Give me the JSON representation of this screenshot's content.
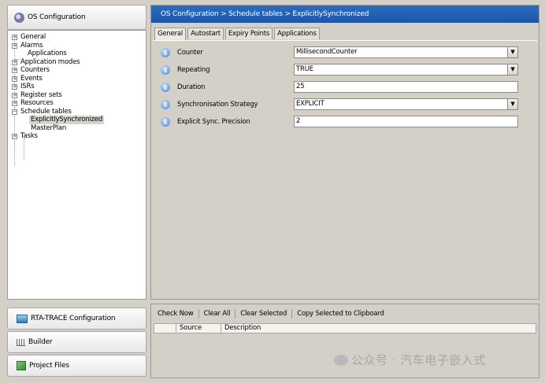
{
  "left_panel": {
    "title": "OS Configuration",
    "tree": [
      {
        "label": "General",
        "expandable": true
      },
      {
        "label": "Alarms",
        "expandable": true
      },
      {
        "label": "Applications",
        "expandable": false
      },
      {
        "label": "Application modes",
        "expandable": true
      },
      {
        "label": "Counters",
        "expandable": true
      },
      {
        "label": "Events",
        "expandable": true
      },
      {
        "label": "ISRs",
        "expandable": true
      },
      {
        "label": "Register sets",
        "expandable": true
      },
      {
        "label": "Resources",
        "expandable": true
      },
      {
        "label": "Schedule tables",
        "expandable": true,
        "expanded": true
      },
      {
        "label": "ExplicitlySynchronized",
        "child": true,
        "selected": true
      },
      {
        "label": "MasterPlan",
        "child": true
      },
      {
        "label": "Tasks",
        "expandable": true
      }
    ],
    "buttons": {
      "trace": "RTA-TRACE Configuration",
      "builder": "Builder",
      "project_files": "Project Files"
    }
  },
  "main": {
    "breadcrumb": "OS Configuration  >  Schedule tables  >  ExplicitlySynchronized",
    "tabs": [
      "General",
      "Autostart",
      "Expiry Points",
      "Applications"
    ],
    "active_tab": "General",
    "fields": [
      {
        "label": "Counter",
        "value": "MillisecondCounter",
        "type": "dropdown"
      },
      {
        "label": "Repeating",
        "value": "TRUE",
        "type": "dropdown"
      },
      {
        "label": "Duration",
        "value": "25",
        "type": "text"
      },
      {
        "label": "Synchronisation Strategy",
        "value": "EXPLICIT",
        "type": "dropdown"
      },
      {
        "label": "Explicit Sync. Precision",
        "value": "2",
        "type": "text"
      }
    ]
  },
  "bottom": {
    "toolbar": [
      "Check Now",
      "Clear All",
      "Clear Selected",
      "Copy Selected to Clipboard"
    ],
    "columns": [
      "",
      "Source",
      "Description"
    ]
  },
  "watermark": "公众号 · 汽车电子嵌入式",
  "colors": {
    "breadcrumb_bg": "#2461b8",
    "selection": "#d6d3ce"
  }
}
